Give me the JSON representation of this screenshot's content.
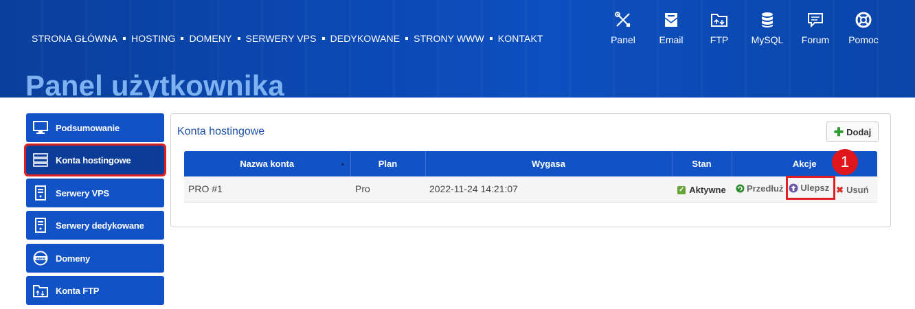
{
  "header": {
    "nav": [
      "STRONA GŁÓWNA",
      "HOSTING",
      "DOMENY",
      "SERWERY VPS",
      "DEDYKOWANE",
      "STRONY WWW",
      "KONTAKT"
    ],
    "icons": [
      {
        "label": "Panel",
        "icon": "tools-icon"
      },
      {
        "label": "Email",
        "icon": "email-icon"
      },
      {
        "label": "FTP",
        "icon": "ftp-folder-icon"
      },
      {
        "label": "MySQL",
        "icon": "database-icon"
      },
      {
        "label": "Forum",
        "icon": "forum-icon"
      },
      {
        "label": "Pomoc",
        "icon": "lifebuoy-icon"
      }
    ],
    "page_title": "Panel użytkownika"
  },
  "sidebar": {
    "items": [
      {
        "label": "Podsumowanie",
        "icon": "monitor-icon",
        "active": false
      },
      {
        "label": "Konta hostingowe",
        "icon": "server-icon",
        "active": true
      },
      {
        "label": "Serwery VPS",
        "icon": "server-tower-icon",
        "active": false
      },
      {
        "label": "Serwery dedykowane",
        "icon": "server-tower-icon",
        "active": false
      },
      {
        "label": "Domeny",
        "icon": "www-globe-icon",
        "active": false
      },
      {
        "label": "Konta FTP",
        "icon": "ftp-folder-icon",
        "active": false
      }
    ]
  },
  "main": {
    "title": "Konta hostingowe",
    "add_label": "Dodaj",
    "table": {
      "headers": [
        "Nazwa konta",
        "Plan",
        "Wygasa",
        "Stan",
        "Akcje"
      ],
      "rows": [
        {
          "name": "PRO #1",
          "plan": "Pro",
          "expires": "2022-11-24 14:21:07",
          "status": "Aktywne",
          "actions": {
            "renew": "Przedłuż",
            "upgrade": "Ulepsz",
            "delete": "Usuń"
          }
        }
      ]
    }
  },
  "annotation": {
    "step": "1"
  },
  "colors": {
    "brand_blue": "#1152c6",
    "header_blue": "#0b49b4",
    "highlight_red": "#e02020",
    "title_light_blue": "#7fb2f0"
  }
}
